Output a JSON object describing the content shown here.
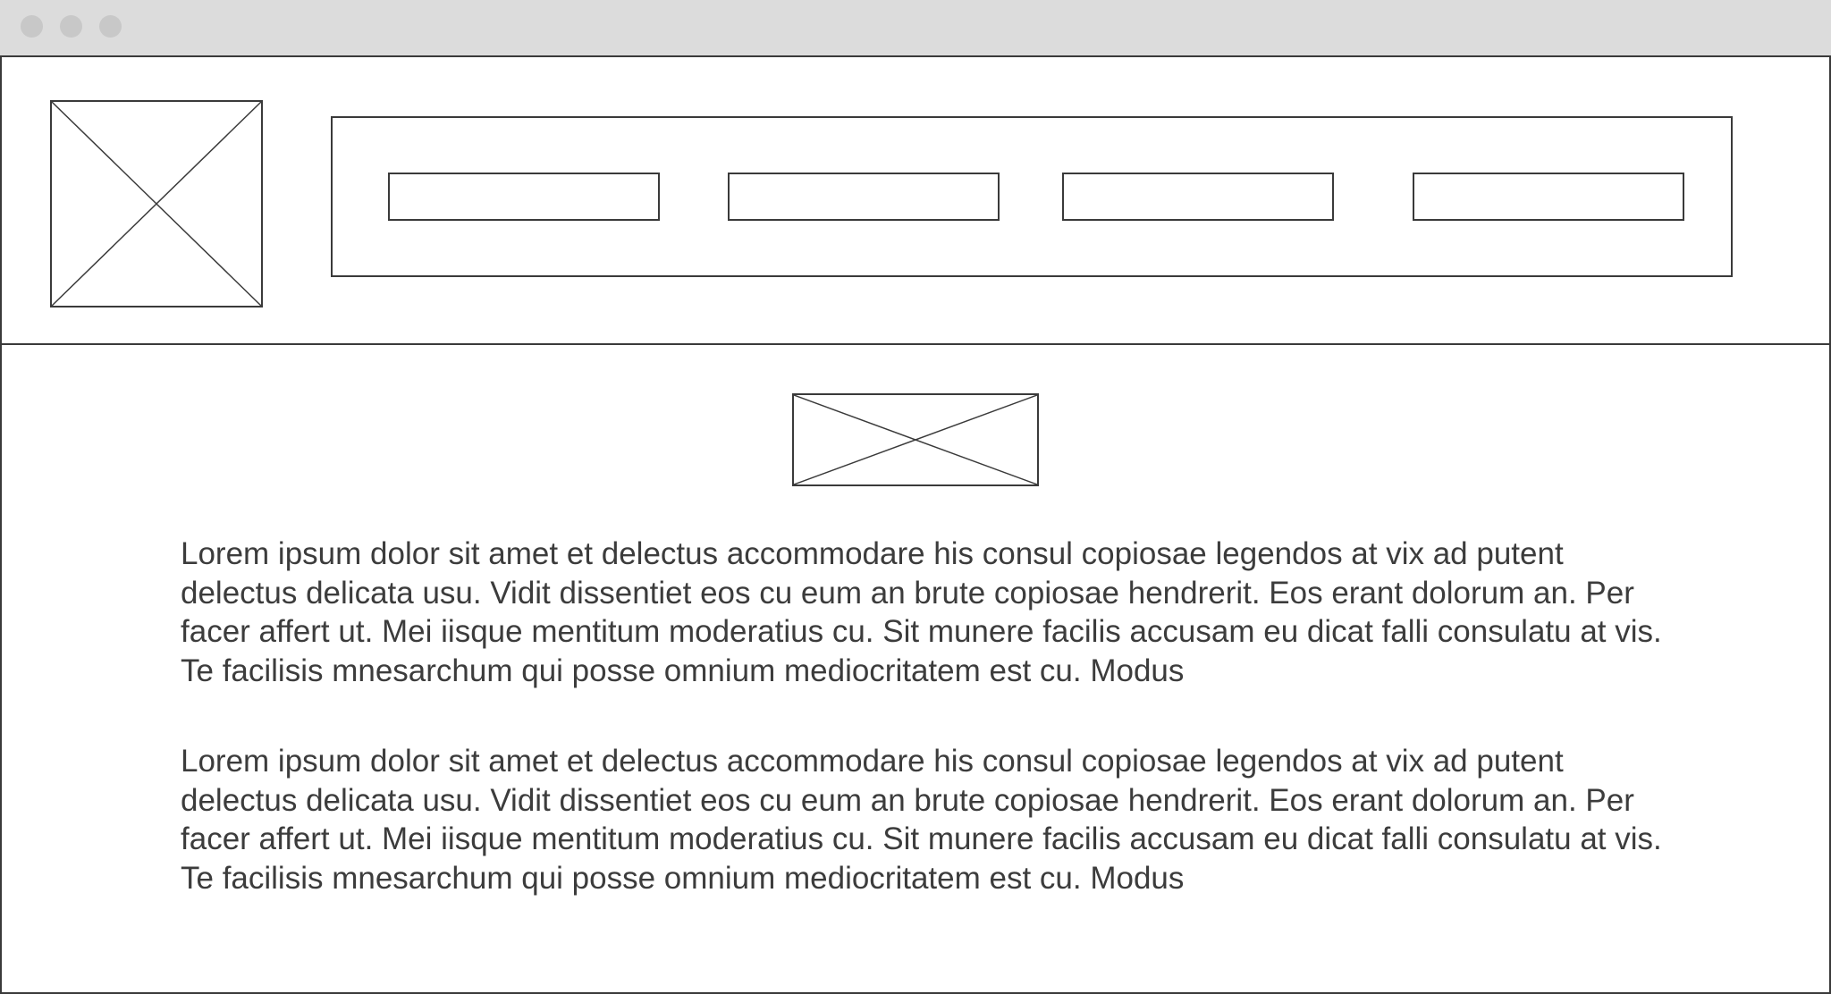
{
  "window": {
    "traffic_lights": [
      "close-dot",
      "minimize-dot",
      "maximize-dot"
    ],
    "colors": {
      "titlebar": "#dcdcdc",
      "stroke": "#3a3a3a",
      "text": "#3c3c3c",
      "background": "#ffffff"
    }
  },
  "header": {
    "logo_icon": "image-placeholder-icon",
    "nav_items": [
      "",
      "",
      "",
      ""
    ]
  },
  "main": {
    "hero_icon": "image-placeholder-icon",
    "paragraphs": [
      "Lorem ipsum dolor sit amet et delectus accommodare his consul copiosae legendos at vix ad putent delectus delicata usu. Vidit dissentiet eos cu eum an brute copiosae hendrerit. Eos erant dolorum an. Per facer affert ut. Mei iisque mentitum moderatius cu. Sit munere facilis accusam eu dicat falli consulatu at vis. Te facilisis mnesarchum qui posse omnium mediocritatem est cu. Modus",
      "Lorem ipsum dolor sit amet et delectus accommodare his consul copiosae legendos at vix ad putent delectus delicata usu. Vidit dissentiet eos cu eum an brute copiosae hendrerit. Eos erant dolorum an. Per facer affert ut. Mei iisque mentitum moderatius cu. Sit munere facilis accusam eu dicat falli consulatu at vis. Te facilisis mnesarchum qui posse omnium mediocritatem est cu. Modus"
    ]
  }
}
